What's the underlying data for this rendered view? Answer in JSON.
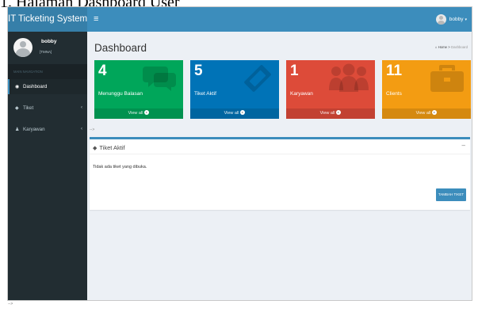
{
  "doc_caption": "1.   Halaman Dashboard User",
  "header": {
    "logo_text": "IT Ticketing System",
    "toggle_icon": "hamburger-icon",
    "user_name": "bobby",
    "brand_color": "#3c8dbc"
  },
  "sidebar": {
    "user_name": "bobby",
    "user_role": "[TMNA]",
    "nav_header": "MAIN NAVIGATION",
    "items": [
      {
        "label": "Dashboard",
        "icon": "dashboard-icon",
        "active": true
      },
      {
        "label": "Tiket",
        "icon": "ticket-icon",
        "has_submenu": true
      },
      {
        "label": "Karyawan",
        "icon": "users-icon",
        "has_submenu": true
      }
    ]
  },
  "main": {
    "title": "Dashboard",
    "breadcrumb": {
      "home": "Home",
      "current": "Dashboard"
    },
    "stat_boxes": [
      {
        "value": "4",
        "label": "Menunggu Balasan",
        "link": "View all",
        "color": "#00a65a",
        "icon": "comments-icon"
      },
      {
        "value": "5",
        "label": "Tiket Aktif",
        "link": "View all",
        "color": "#0073b7",
        "icon": "ticket-icon"
      },
      {
        "value": "1",
        "label": "Karyawan",
        "link": "View all",
        "color": "#dd4b39",
        "icon": "users-icon"
      },
      {
        "value": "11",
        "label": "Clients",
        "link": "View all",
        "color": "#f39c12",
        "icon": "briefcase-icon"
      }
    ],
    "stray_text": "-->",
    "panel": {
      "title": "Tiket Aktif",
      "collapse": "–",
      "empty_message": "Tidak ada tiket yang dibuka.",
      "add_button": "TAMBAH TIKET"
    }
  },
  "footer_text": "-->"
}
